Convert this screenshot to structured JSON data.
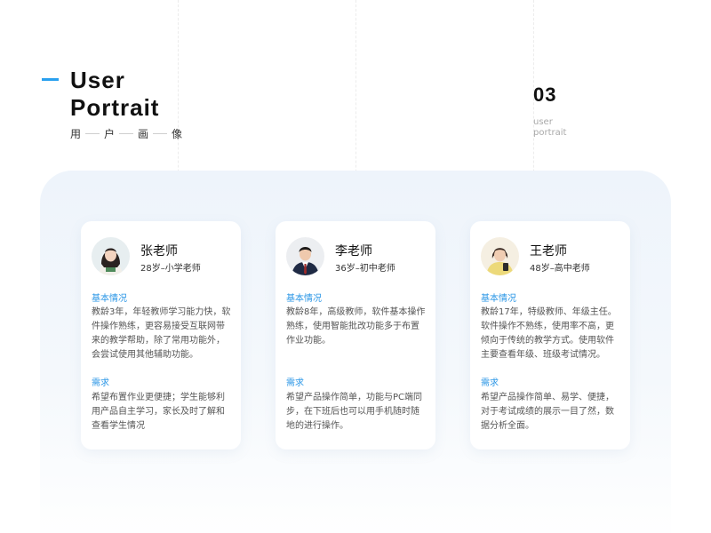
{
  "header": {
    "title_line1": "User",
    "title_line2": "Portrait",
    "subtitle_chars": [
      "用",
      "户",
      "画",
      "像"
    ]
  },
  "page": {
    "number": "03",
    "label_line1": "user",
    "label_line2": "portrait"
  },
  "cards": [
    {
      "name": "张老师",
      "desc": "28岁–小学老师",
      "section1_title": "基本情况",
      "section1_body": "教龄3年，年轻教师学习能力快，软件操作熟练，更容易接受互联网带来的教学帮助，除了常用功能外，会尝试使用其他辅助功能。",
      "section2_title": "需求",
      "section2_body": "希望布置作业更便捷；学生能够利用产品自主学习，家长及时了解和查看学生情况"
    },
    {
      "name": "李老师",
      "desc": "36岁–初中老师",
      "section1_title": "基本情况",
      "section1_body": "教龄8年，高级教师，软件基本操作熟练，使用智能批改功能多于布置作业功能。",
      "section2_title": "需求",
      "section2_body": "希望产品操作简单，功能与PC端同步，在下班后也可以用手机随时随地的进行操作。"
    },
    {
      "name": "王老师",
      "desc": "48岁–高中老师",
      "section1_title": "基本情况",
      "section1_body": "教龄17年，特级教师、年级主任。软件操作不熟练，使用率不高，更倾向于传统的教学方式。使用软件主要查看年级、班级考试情况。",
      "section2_title": "需求",
      "section2_body": "希望产品操作简单、易学、便捷，对于考试成绩的展示一目了然，数据分析全面。"
    }
  ],
  "colors": {
    "accent": "#2aa0ef",
    "section_title": "#2a96e6",
    "panel": "#eef4fb"
  }
}
